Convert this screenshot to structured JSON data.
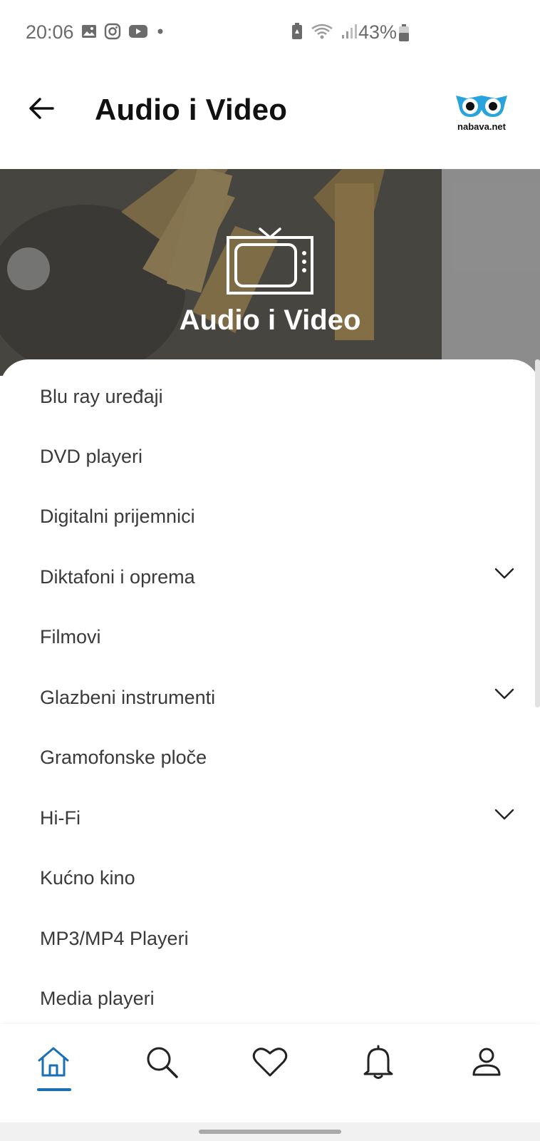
{
  "status_bar": {
    "time": "20:06",
    "battery_percent": "43%",
    "left_icons": [
      "gallery-icon",
      "instagram-icon",
      "youtube-icon",
      "dot-icon"
    ],
    "right_icons": [
      "battery-saver-icon",
      "wifi-icon",
      "signal-icon",
      "battery-icon"
    ]
  },
  "header": {
    "title": "Audio i Video",
    "logo_text": "nabava.net",
    "back_icon": "arrow-left-icon"
  },
  "hero": {
    "title": "Audio i Video",
    "icon": "tv-icon"
  },
  "categories": [
    {
      "label": "Blu ray uređaji",
      "expandable": false
    },
    {
      "label": "DVD playeri",
      "expandable": false
    },
    {
      "label": "Digitalni prijemnici",
      "expandable": false
    },
    {
      "label": "Diktafoni i oprema",
      "expandable": true
    },
    {
      "label": "Filmovi",
      "expandable": false
    },
    {
      "label": "Glazbeni instrumenti",
      "expandable": true
    },
    {
      "label": "Gramofonske ploče",
      "expandable": false
    },
    {
      "label": "Hi-Fi",
      "expandable": true
    },
    {
      "label": "Kućno kino",
      "expandable": false
    },
    {
      "label": "MP3/MP4 Playeri",
      "expandable": false
    },
    {
      "label": "Media playeri",
      "expandable": false
    }
  ],
  "bottom_nav": {
    "items": [
      "home-icon",
      "search-icon",
      "heart-icon",
      "bell-icon",
      "profile-icon"
    ],
    "active": "home-icon"
  },
  "colors": {
    "accent": "#1a6fb5",
    "logo_blue": "#29a3dd",
    "title_text": "#111111",
    "category_text": "#3a3a3a"
  }
}
